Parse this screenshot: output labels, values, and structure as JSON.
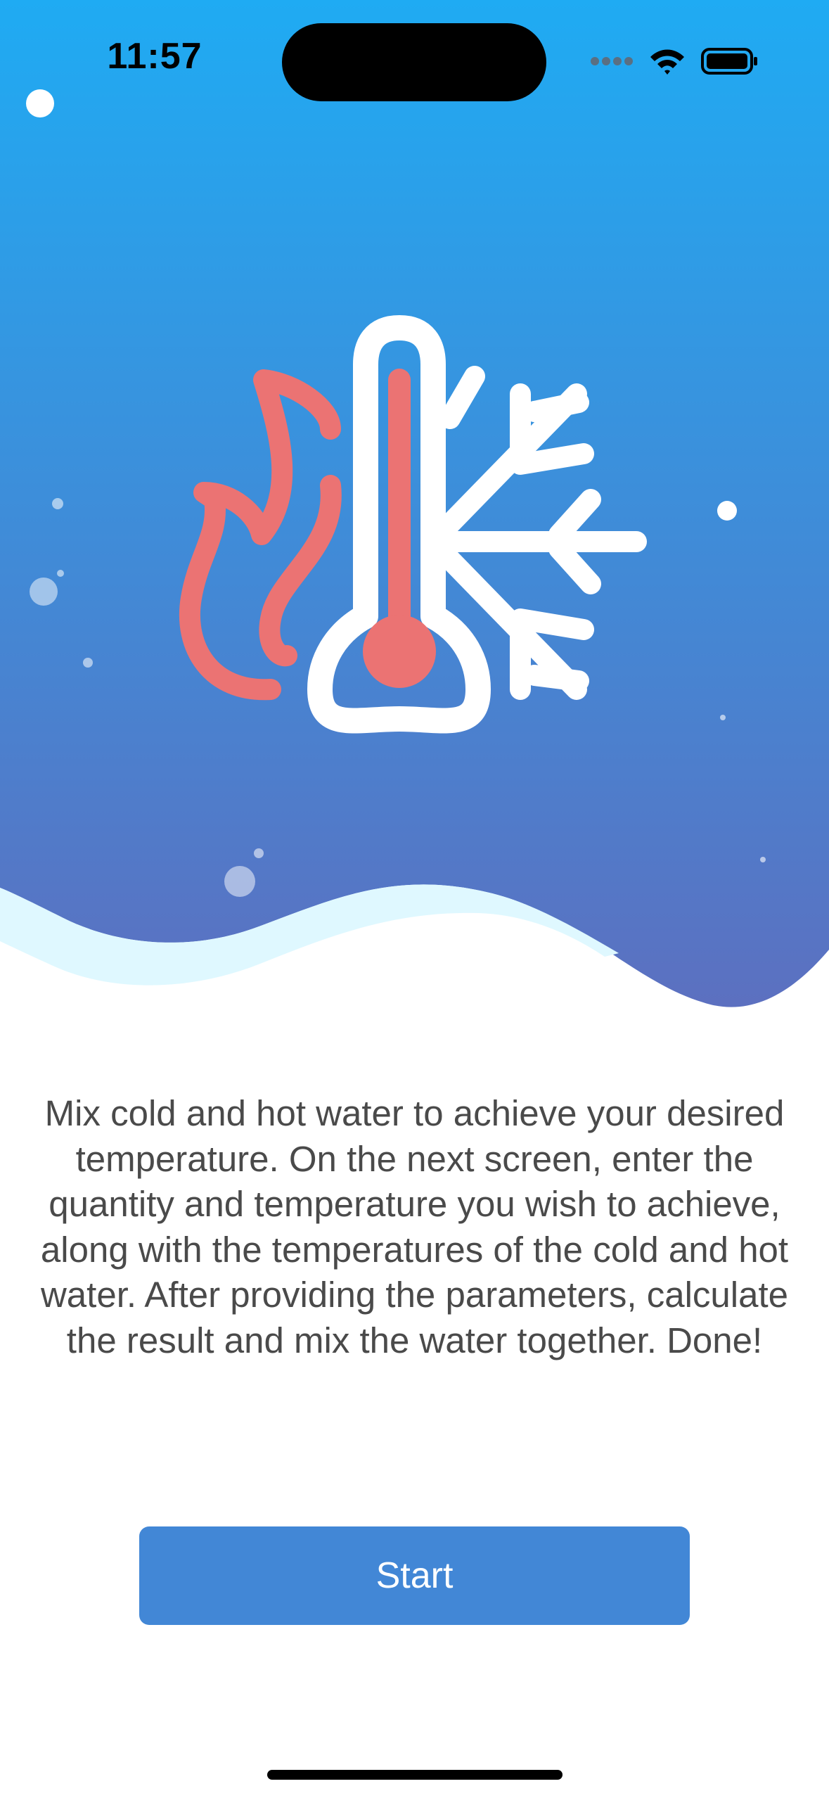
{
  "status_bar": {
    "time": "11:57",
    "icons": [
      "signal-icon",
      "wifi-icon",
      "battery-icon"
    ]
  },
  "hero": {
    "illustration": "thermometer-fire-snowflake-icon",
    "colors": {
      "gradient_top": "#1fabf3",
      "gradient_bottom": "#5c70c0",
      "wave_highlight": "#dff8ff",
      "flame": "#eb7373",
      "icon_white": "#ffffff"
    }
  },
  "intro": {
    "text": "Mix cold and hot water to achieve your desired temperature. On the next screen, enter the quantity and temperature you wish to achieve, along with the temperatures of the cold and hot water. After providing the parameters, calculate the result and mix the water together. Done!"
  },
  "start_button": {
    "label": "Start",
    "color": "#4287d6"
  }
}
